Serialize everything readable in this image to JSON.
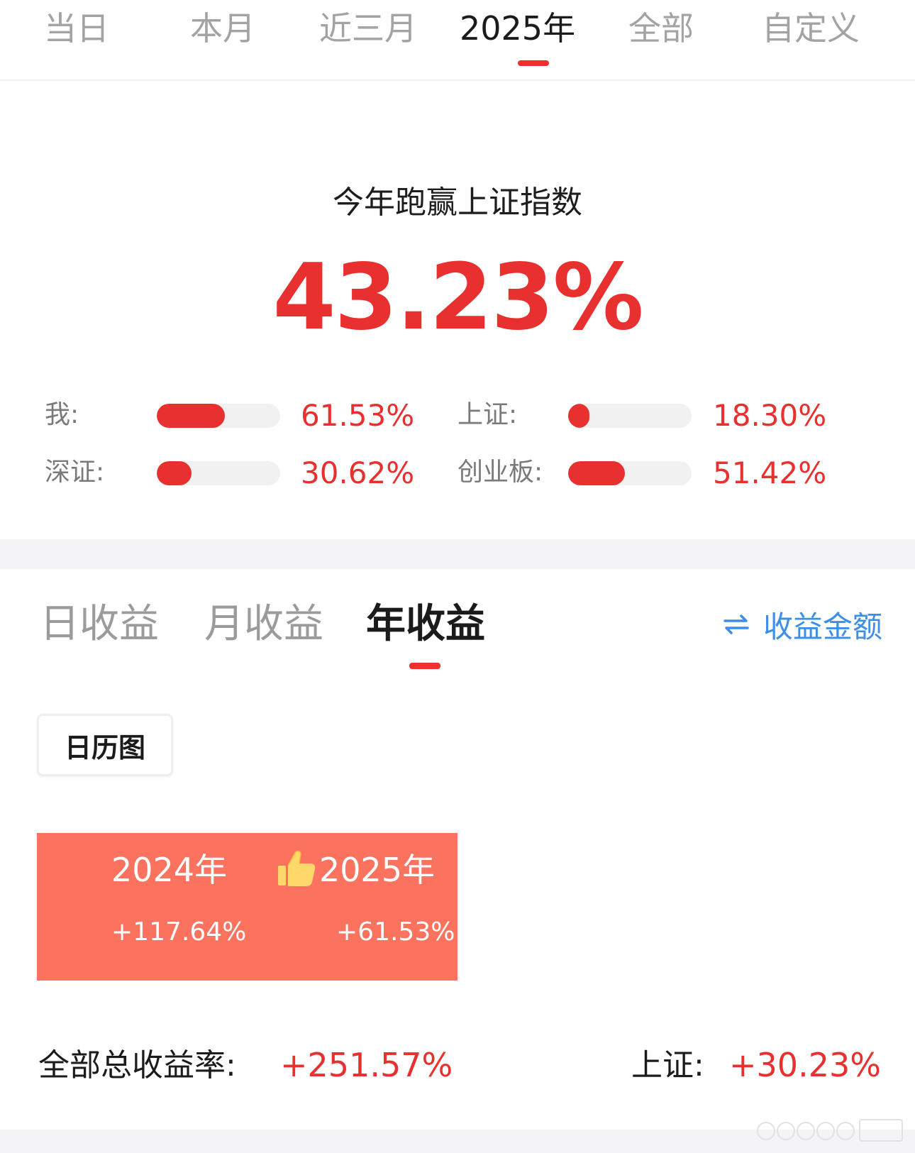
{
  "period_tabs": [
    {
      "label": "当日"
    },
    {
      "label": "本月"
    },
    {
      "label": "近三月"
    },
    {
      "label": "2025年"
    },
    {
      "label": "全部"
    },
    {
      "label": "自定义"
    }
  ],
  "selected_period": "2025年",
  "beat": {
    "title": "今年跑赢上证指数",
    "value": "43.23%"
  },
  "comparison": [
    {
      "label": "我:",
      "value": "61.53%"
    },
    {
      "label": "上证:",
      "value": "18.30%"
    },
    {
      "label": "深证:",
      "value": "30.62%"
    },
    {
      "label": "创业板:",
      "value": "51.42%"
    }
  ],
  "returns_tabs": [
    {
      "label": "日收益"
    },
    {
      "label": "月收益"
    },
    {
      "label": "年收益"
    }
  ],
  "selected_returns_tab": "年收益",
  "amount_toggle": {
    "label": "收益金额",
    "icon": "swap-arrows-icon"
  },
  "calendar_button": {
    "label": "日历图"
  },
  "years": [
    {
      "year": "2024年",
      "return": "+117.64%"
    },
    {
      "year": "2025年",
      "return": "+61.53%",
      "icon": "thumbs-up-icon"
    }
  ],
  "summary": {
    "total_label": "全部总收益率:",
    "total_value": "+251.57%",
    "index_label": "上证:",
    "index_value": "+30.23%"
  },
  "colors": {
    "accent_red": "#e8302f",
    "year_cell": "#fb735e",
    "link_blue": "#3c8fe8",
    "track_gray": "#f1f1f1"
  }
}
